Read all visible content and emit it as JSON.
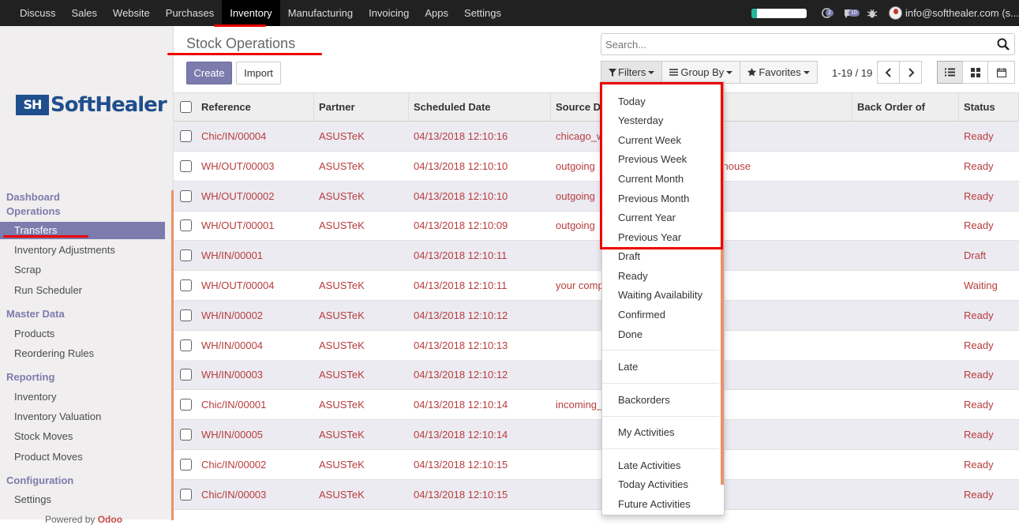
{
  "top_menu": [
    "Discuss",
    "Sales",
    "Website",
    "Purchases",
    "Inventory",
    "Manufacturing",
    "Invoicing",
    "Apps",
    "Settings"
  ],
  "active_menu": "Inventory",
  "systray": {
    "progress_fraction": 0.1,
    "activity_badge": "2",
    "messages_badge": "10",
    "user": "info@softhealer.com (s..."
  },
  "brand": {
    "mark": "SH",
    "name": "SoftHealer"
  },
  "sidebar": {
    "sections": [
      {
        "title": "Dashboard Operations",
        "items": [
          "Transfers",
          "Inventory Adjustments",
          "Scrap",
          "Run Scheduler"
        ]
      },
      {
        "title": "Master Data",
        "items": [
          "Products",
          "Reordering Rules"
        ]
      },
      {
        "title": "Reporting",
        "items": [
          "Inventory",
          "Inventory Valuation",
          "Stock Moves",
          "Product Moves"
        ]
      },
      {
        "title": "Configuration",
        "items": [
          "Settings"
        ]
      }
    ],
    "active_item": "Transfers",
    "powered_by_prefix": "Powered by",
    "powered_by_brand": "Odoo"
  },
  "page": {
    "title": "Stock Operations",
    "create_label": "Create",
    "import_label": "Import",
    "search_placeholder": "Search...",
    "filters_label": "Filters",
    "group_by_label": "Group By",
    "favorites_label": "Favorites",
    "pager": "1-19 / 19"
  },
  "table": {
    "columns": [
      "Reference",
      "Partner",
      "Scheduled Date",
      "Source Document",
      "",
      "Back Order of",
      "Status"
    ],
    "rows": [
      {
        "ref": "Chic/IN/00004",
        "partner": "ASUSTeK",
        "date": "04/13/2018 12:10:16",
        "source": "chicago_w",
        "source2": "",
        "status": "Ready"
      },
      {
        "ref": "WH/OUT/00003",
        "partner": "ASUSTeK",
        "date": "04/13/2018 12:10:10",
        "source": "outgoing",
        "source2": "rehouse",
        "status": "Ready"
      },
      {
        "ref": "WH/OUT/00002",
        "partner": "ASUSTeK",
        "date": "04/13/2018 12:10:10",
        "source": "outgoing",
        "source2": "",
        "status": "Ready"
      },
      {
        "ref": "WH/OUT/00001",
        "partner": "ASUSTeK",
        "date": "04/13/2018 12:10:09",
        "source": "outgoing",
        "source2": "",
        "status": "Ready"
      },
      {
        "ref": "WH/IN/00001",
        "partner": "",
        "date": "04/13/2018 12:10:11",
        "source": "",
        "source2": "",
        "status": "Draft"
      },
      {
        "ref": "WH/OUT/00004",
        "partner": "ASUSTeK",
        "date": "04/13/2018 12:10:11",
        "source": "your comp",
        "source2": "",
        "status": "Waiting"
      },
      {
        "ref": "WH/IN/00002",
        "partner": "ASUSTeK",
        "date": "04/13/2018 12:10:12",
        "source": "",
        "source2": "",
        "status": "Ready"
      },
      {
        "ref": "WH/IN/00004",
        "partner": "ASUSTeK",
        "date": "04/13/2018 12:10:13",
        "source": "",
        "source2": "",
        "status": "Ready"
      },
      {
        "ref": "WH/IN/00003",
        "partner": "ASUSTeK",
        "date": "04/13/2018 12:10:12",
        "source": "",
        "source2": "",
        "status": "Ready"
      },
      {
        "ref": "Chic/IN/00001",
        "partner": "ASUSTeK",
        "date": "04/13/2018 12:10:14",
        "source": "incoming_",
        "source2": "",
        "status": "Ready"
      },
      {
        "ref": "WH/IN/00005",
        "partner": "ASUSTeK",
        "date": "04/13/2018 12:10:14",
        "source": "",
        "source2": "",
        "status": "Ready"
      },
      {
        "ref": "Chic/IN/00002",
        "partner": "ASUSTeK",
        "date": "04/13/2018 12:10:15",
        "source": "",
        "source2": "",
        "status": "Ready"
      },
      {
        "ref": "Chic/IN/00003",
        "partner": "ASUSTeK",
        "date": "04/13/2018 12:10:15",
        "source": "",
        "source2": "",
        "status": "Ready"
      }
    ]
  },
  "filters_menu": {
    "groups": [
      [
        "Today",
        "Yesterday",
        "Current Week",
        "Previous Week",
        "Current Month",
        "Previous Month",
        "Current Year",
        "Previous Year",
        "Draft",
        "Ready",
        "Waiting Availability",
        "Confirmed",
        "Done"
      ],
      [
        "Late"
      ],
      [
        "Backorders"
      ],
      [
        "My Activities"
      ],
      [
        "Late Activities",
        "Today Activities",
        "Future Activities"
      ]
    ]
  },
  "colors": {
    "topbar": "#212121",
    "accent": "#7c7bad",
    "row_text": "#b73d3d",
    "highlight": "#e00000"
  }
}
